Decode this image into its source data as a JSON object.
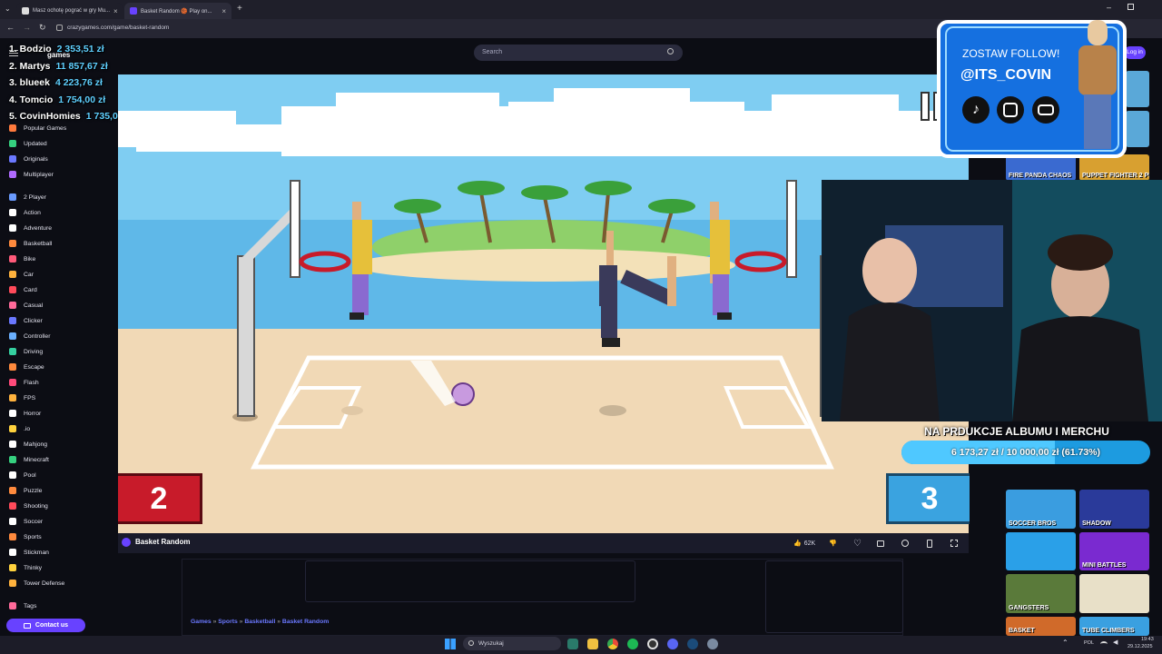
{
  "browser": {
    "tabs": [
      {
        "title": "Masz ochotę pograć w gry Mu...",
        "active": false
      },
      {
        "title": "Basket Random 🏀 Play on...",
        "active": true
      }
    ],
    "url": "crazygames.com/game/basket-random"
  },
  "site": {
    "search_placeholder": "Search",
    "logo_text": "games",
    "login_label": "Log in"
  },
  "leaderboard": [
    {
      "rank_name": "1. Bodzio",
      "amount": "2 353,51 zł"
    },
    {
      "rank_name": "2. Martys",
      "amount": "11 857,67 zł"
    },
    {
      "rank_name": "3. blueek",
      "amount": "4 223,76 zł"
    },
    {
      "rank_name": "4. Tomcio",
      "amount": "1 754,00 zł"
    },
    {
      "rank_name": "5. CovinHomies",
      "amount": "1 735,00 zł"
    }
  ],
  "sidebar": {
    "items": [
      {
        "label": "Popular Games",
        "icon": "fire-icon",
        "color": "#ff7a3d"
      },
      {
        "label": "Updated",
        "icon": "refresh-icon",
        "color": "#35d07f"
      },
      {
        "label": "Originals",
        "icon": "star-icon",
        "color": "#6a78ff"
      },
      {
        "label": "Multiplayer",
        "icon": "users-icon",
        "color": "#b06aff"
      },
      {
        "label": "2 Player",
        "icon": "two-player-icon",
        "color": "#6a9bff"
      },
      {
        "label": "Action",
        "icon": "sword-icon",
        "color": "#ffffff"
      },
      {
        "label": "Adventure",
        "icon": "compass-icon",
        "color": "#ffffff"
      },
      {
        "label": "Basketball",
        "icon": "basketball-icon",
        "color": "#ff8a3d"
      },
      {
        "label": "Bike",
        "icon": "bike-icon",
        "color": "#ff5a7a"
      },
      {
        "label": "Car",
        "icon": "car-icon",
        "color": "#ffb23d"
      },
      {
        "label": "Card",
        "icon": "card-icon",
        "color": "#ff4a5a"
      },
      {
        "label": "Casual",
        "icon": "casual-icon",
        "color": "#ff6a9a"
      },
      {
        "label": "Clicker",
        "icon": "cursor-icon",
        "color": "#6a78ff"
      },
      {
        "label": "Controller",
        "icon": "controller-icon",
        "color": "#6ab0ff"
      },
      {
        "label": "Driving",
        "icon": "steering-icon",
        "color": "#35d0a0"
      },
      {
        "label": "Escape",
        "icon": "door-icon",
        "color": "#ff8a3d"
      },
      {
        "label": "Flash",
        "icon": "flash-icon",
        "color": "#ff4a7a"
      },
      {
        "label": "FPS",
        "icon": "gun-icon",
        "color": "#ffb23d"
      },
      {
        "label": "Horror",
        "icon": "ghost-icon",
        "color": "#ffffff"
      },
      {
        "label": ".io",
        "icon": "pacman-icon",
        "color": "#ffd23d"
      },
      {
        "label": "Mahjong",
        "icon": "mahjong-icon",
        "color": "#ffffff"
      },
      {
        "label": "Minecraft",
        "icon": "minecraft-icon",
        "color": "#35d07f"
      },
      {
        "label": "Pool",
        "icon": "pool-ball-icon",
        "color": "#ffffff"
      },
      {
        "label": "Puzzle",
        "icon": "puzzle-icon",
        "color": "#ff8a3d"
      },
      {
        "label": "Shooting",
        "icon": "target-icon",
        "color": "#ff4a5a"
      },
      {
        "label": "Soccer",
        "icon": "soccer-icon",
        "color": "#ffffff"
      },
      {
        "label": "Sports",
        "icon": "sports-icon",
        "color": "#ff8a3d"
      },
      {
        "label": "Stickman",
        "icon": "stickman-icon",
        "color": "#ffffff"
      },
      {
        "label": "Thinky",
        "icon": "bulb-icon",
        "color": "#ffd23d"
      },
      {
        "label": "Tower Defense",
        "icon": "tower-icon",
        "color": "#ffb23d"
      },
      {
        "label": "Tags",
        "icon": "tag-icon",
        "color": "#ff6a9a"
      }
    ],
    "contact_label": "Contact us"
  },
  "game": {
    "title": "Basket Random",
    "score_left": "2",
    "score_right": "3",
    "likes": "62K",
    "colors": {
      "sky": "#7fcdf2",
      "sand": "#f1d9b6",
      "score_left": "#c81b2a",
      "score_right": "#3aa3e0"
    }
  },
  "breadcrumbs": [
    "Games",
    "Sports",
    "Basketball",
    "Basket Random"
  ],
  "breadcrumb_sep": "»",
  "overlay": {
    "follow_title": "ZOSTAW FOLLOW!",
    "handle": "@ITS_COVIN",
    "donation_title": "NA PRDUKCJE ALBUMU I MERCHU",
    "donation_text": "6 173,27 zł / 10 000,00 zł (61.73%)",
    "donation_progress": 0.6173
  },
  "thumbnails": [
    {
      "label": "FIRE PANDA CHAOS",
      "color": "#3a6ad0"
    },
    {
      "label": "PUPPET FIGHTER 2 PLAYER",
      "color": "#d8a030"
    },
    {
      "label": "SOCCER BROS",
      "color": "#3a9de0"
    },
    {
      "label": "SHADOW",
      "color": "#2a3a9a"
    },
    {
      "label": "",
      "color": "#2aa0e8"
    },
    {
      "label": "MINI BATTLES",
      "color": "#7a2ad0"
    },
    {
      "label": "GANGSTERS",
      "color": "#5a7a3a"
    },
    {
      "label": "",
      "color": "#e8e0c8"
    },
    {
      "label": "BASKET",
      "color": "#d06a2a"
    },
    {
      "label": "TUBE CLIMBERS",
      "color": "#3aa0e0"
    }
  ],
  "taskbar": {
    "search_placeholder": "Wyszukaj",
    "lang": "POL",
    "time": "19:43",
    "date": "29.12.2025"
  }
}
